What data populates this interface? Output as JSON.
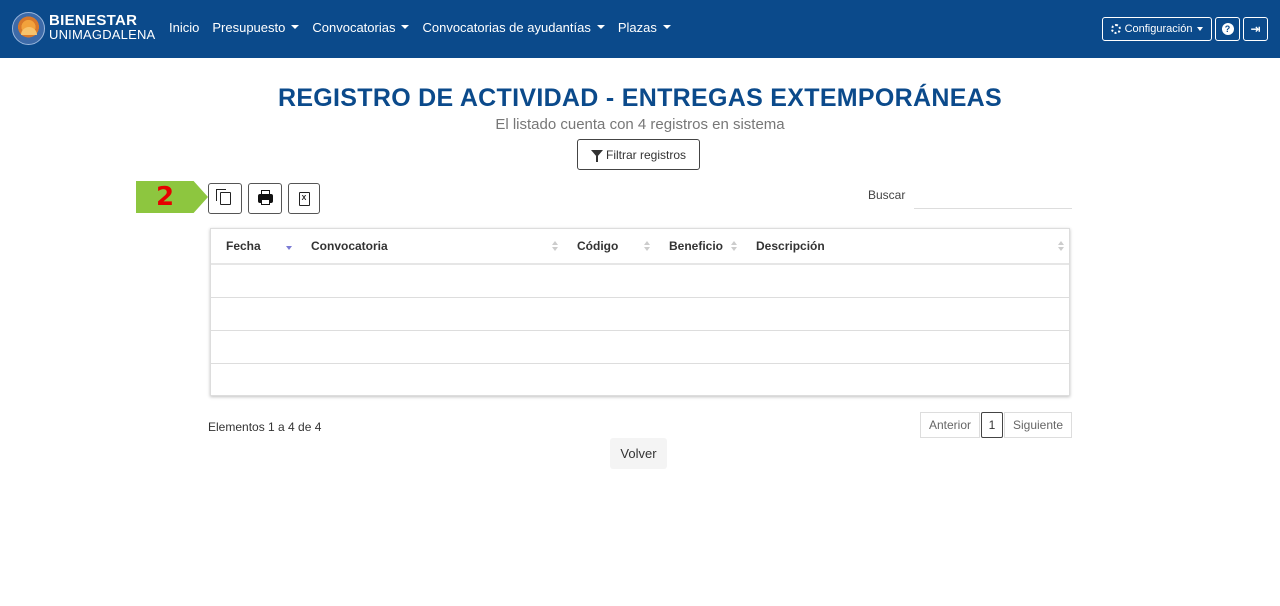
{
  "brand": {
    "top": "BIENESTAR",
    "bottom": "UNIMAGDALENA"
  },
  "nav": {
    "items": [
      {
        "label": "Inicio",
        "dropdown": false
      },
      {
        "label": "Presupuesto",
        "dropdown": true
      },
      {
        "label": "Convocatorias",
        "dropdown": true
      },
      {
        "label": "Convocatorias de ayudantías",
        "dropdown": true
      },
      {
        "label": "Plazas",
        "dropdown": true
      }
    ],
    "config_label": "Configuración",
    "help_icon": "question-circle-icon",
    "exit_icon": "sign-out-icon"
  },
  "page": {
    "title": "REGISTRO DE ACTIVIDAD - ENTREGAS EXTEMPORÁNEAS",
    "subtitle": "El listado cuenta con 4 registros en sistema",
    "filter_label": "Filtrar registros"
  },
  "annotation": {
    "step": "2"
  },
  "toolbar": {
    "copy_icon": "copy-icon",
    "print_icon": "print-icon",
    "excel_icon": "excel-icon",
    "excel_glyph": "X"
  },
  "search": {
    "label": "Buscar",
    "value": "",
    "placeholder": ""
  },
  "table": {
    "columns": [
      "Fecha",
      "Convocatoria",
      "Código",
      "Beneficio",
      "Descripción"
    ],
    "sorted_column": "Fecha",
    "rows": [
      [
        "",
        "",
        "",
        "",
        ""
      ],
      [
        "",
        "",
        "",
        "",
        ""
      ],
      [
        "",
        "",
        "",
        "",
        ""
      ],
      [
        "",
        "",
        "",
        "",
        ""
      ]
    ]
  },
  "pagination": {
    "info": "Elementos 1 a 4 de 4",
    "prev": "Anterior",
    "current": "1",
    "next": "Siguiente"
  },
  "back_label": "Volver",
  "colors": {
    "primary": "#0b4a8b",
    "marker_green": "#8dc63f",
    "marker_red": "#e60000"
  }
}
